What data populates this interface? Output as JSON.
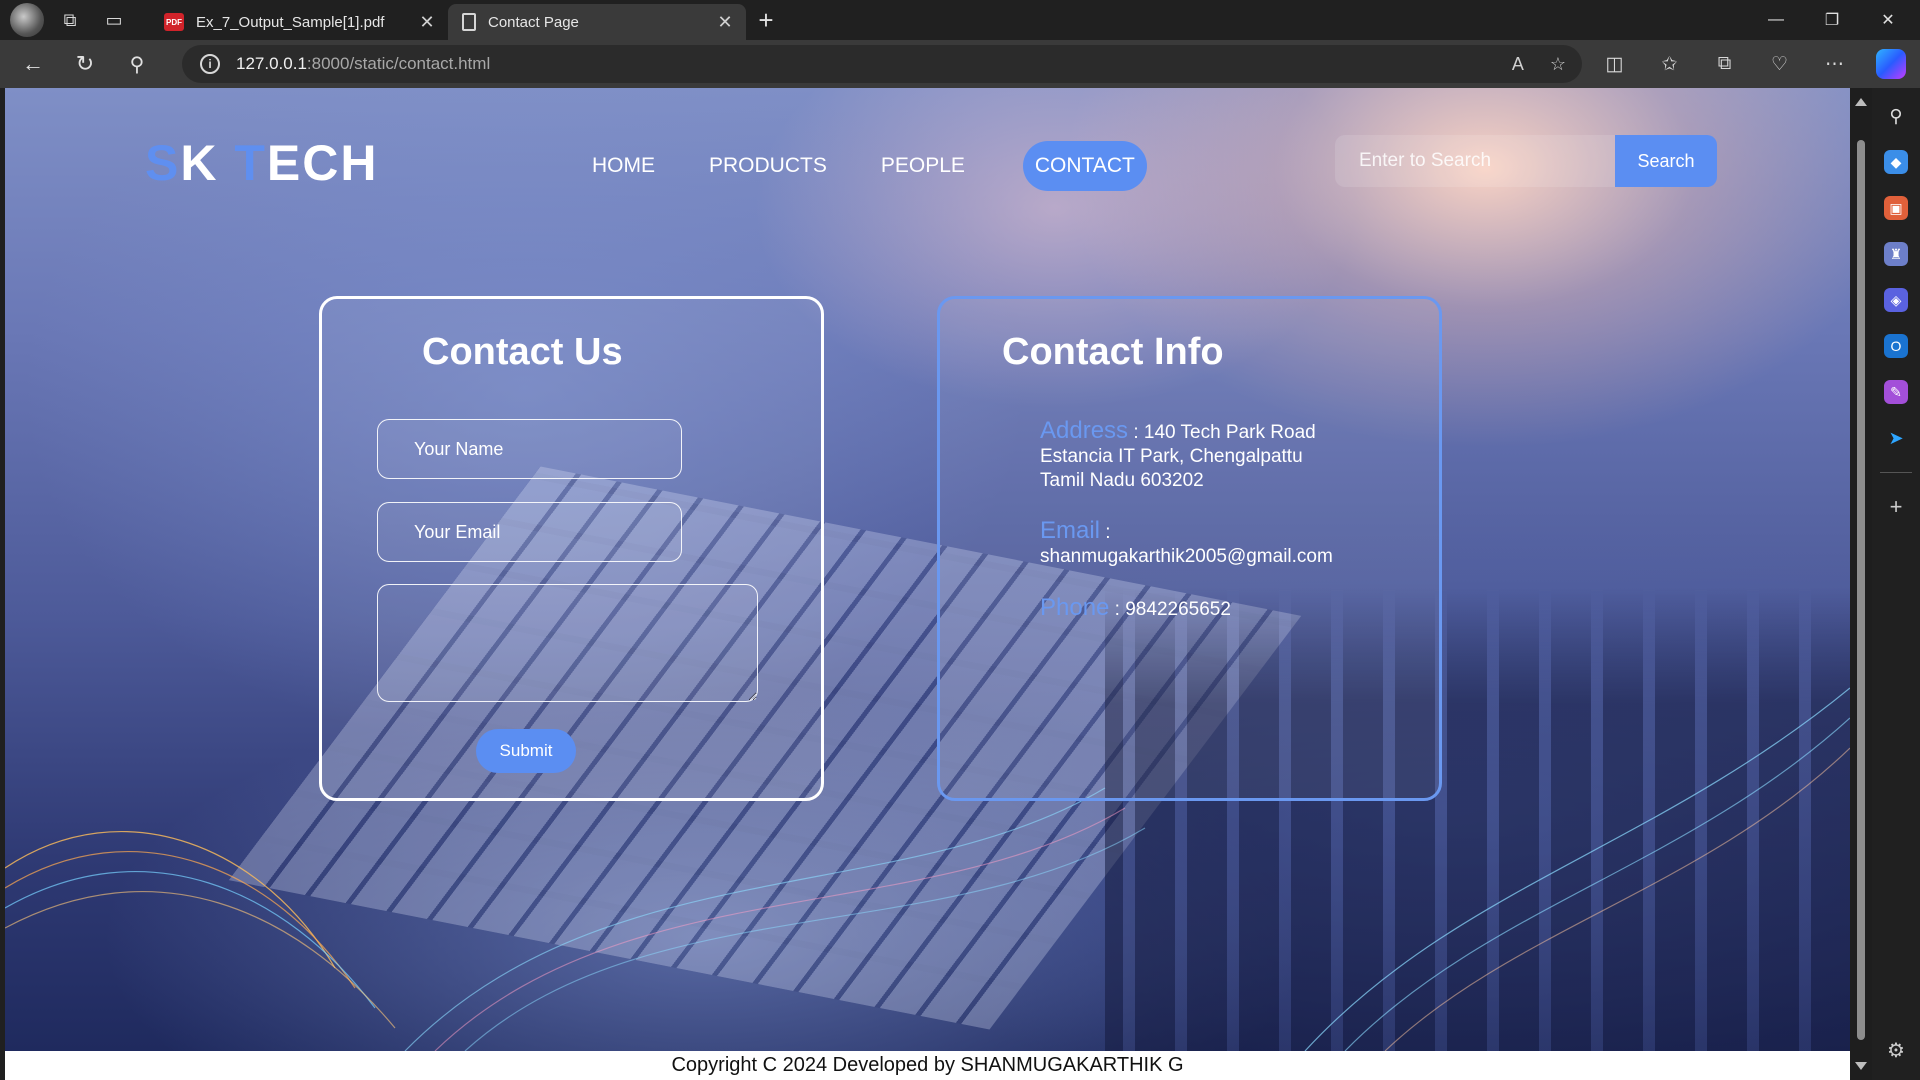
{
  "browser": {
    "tabs": [
      {
        "label": "Ex_7_Output_Sample[1].pdf",
        "icon": "pdf-icon",
        "active": false
      },
      {
        "label": "Contact Page",
        "icon": "page-icon",
        "active": true
      }
    ],
    "address": {
      "host": "127.0.0.1",
      "path": ":8000/static/contact.html"
    },
    "pdf_badge": "PDF"
  },
  "site": {
    "logo": {
      "s": "S",
      "k": "K ",
      "t": "T",
      "ech": "ECH"
    },
    "nav": [
      "HOME",
      "PRODUCTS",
      "PEOPLE",
      "CONTACT"
    ],
    "active_nav": "CONTACT",
    "search": {
      "placeholder": "Enter to Search",
      "button": "Search"
    },
    "form": {
      "title": "Contact Us",
      "name_placeholder": "Your Name",
      "email_placeholder": "Your Email",
      "message_placeholder": "",
      "submit": "Submit"
    },
    "info": {
      "title": "Contact Info",
      "address_label": "Address",
      "address_line1": " : 140 Tech Park Road",
      "address_line2": "Estancia IT Park, Chengalpattu",
      "address_line3": "Tamil Nadu 603202",
      "email_label": "Email",
      "email_sep": " :",
      "email_value": "shanmugakarthik2005@gmail.com",
      "phone_label": "Phone",
      "phone_value": " : 9842265652"
    },
    "footer": "Copyright C 2024 Developed by SHANMUGAKARTHIK G"
  },
  "colors": {
    "accent": "#5b8ef2",
    "info_border": "#6a98f0"
  }
}
